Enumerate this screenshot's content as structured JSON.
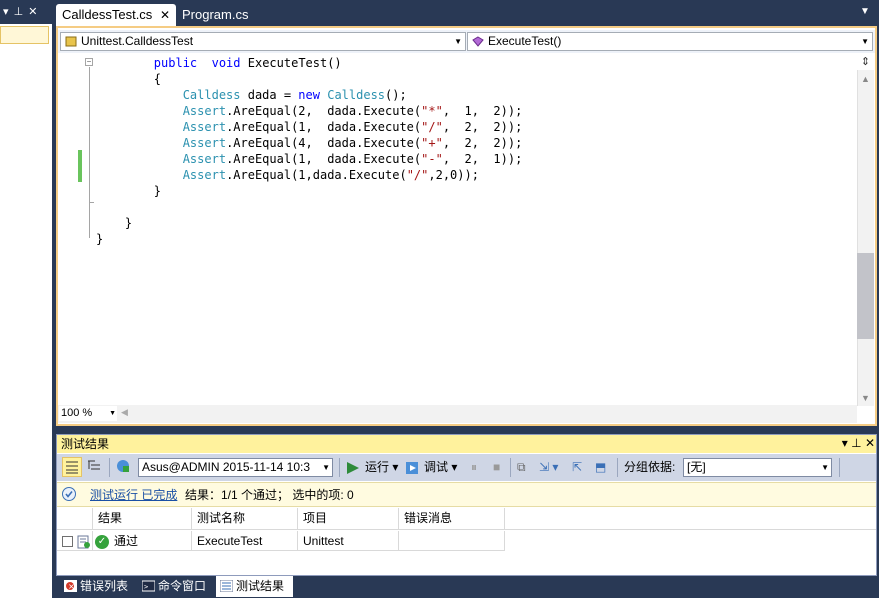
{
  "left_pane": {
    "header_glyphs": "▾ ⊥ ✕"
  },
  "tabs": [
    {
      "label": "CalldessTest.cs",
      "active": true,
      "close": "✕"
    },
    {
      "label": "Program.cs",
      "active": false
    }
  ],
  "nav": {
    "class_combo": "Unittest.CalldessTest",
    "member_combo": "ExecuteTest()"
  },
  "code_lines": [
    {
      "indent": "        ",
      "parts": [
        [
          "kw",
          "public"
        ],
        [
          "",
          "  "
        ],
        [
          "kw",
          "void"
        ],
        [
          "",
          " ExecuteTest()"
        ]
      ]
    },
    {
      "indent": "        ",
      "parts": [
        [
          "",
          "{"
        ]
      ]
    },
    {
      "indent": "            ",
      "parts": [
        [
          "ty",
          "Calldess"
        ],
        [
          "",
          " dada = "
        ],
        [
          "kw",
          "new"
        ],
        [
          "",
          " "
        ],
        [
          "ty",
          "Calldess"
        ],
        [
          "",
          "();"
        ]
      ]
    },
    {
      "indent": "            ",
      "parts": [
        [
          "ty",
          "Assert"
        ],
        [
          "",
          ".AreEqual(2,  dada.Execute("
        ],
        [
          "st",
          "\"*\""
        ],
        [
          "",
          ",  1,  2));"
        ]
      ]
    },
    {
      "indent": "            ",
      "parts": [
        [
          "ty",
          "Assert"
        ],
        [
          "",
          ".AreEqual(1,  dada.Execute("
        ],
        [
          "st",
          "\"/\""
        ],
        [
          "",
          ",  2,  2));"
        ]
      ]
    },
    {
      "indent": "            ",
      "parts": [
        [
          "ty",
          "Assert"
        ],
        [
          "",
          ".AreEqual(4,  dada.Execute("
        ],
        [
          "st",
          "\"+\""
        ],
        [
          "",
          ",  2,  2));"
        ]
      ]
    },
    {
      "indent": "            ",
      "parts": [
        [
          "ty",
          "Assert"
        ],
        [
          "",
          ".AreEqual(1,  dada.Execute("
        ],
        [
          "st",
          "\"-\""
        ],
        [
          "",
          ",  2,  1));"
        ]
      ]
    },
    {
      "indent": "            ",
      "parts": [
        [
          "ty",
          "Assert"
        ],
        [
          "",
          ".AreEqual(1,dada.Execute("
        ],
        [
          "st",
          "\"/\""
        ],
        [
          "",
          ",2,0));"
        ]
      ]
    },
    {
      "indent": "        ",
      "parts": [
        [
          "",
          "}"
        ]
      ]
    },
    {
      "indent": "",
      "parts": [
        [
          "",
          ""
        ]
      ]
    },
    {
      "indent": "    ",
      "parts": [
        [
          "",
          "}"
        ]
      ]
    },
    {
      "indent": "",
      "parts": [
        [
          "",
          "}"
        ]
      ]
    }
  ],
  "zoom": "100 %",
  "results": {
    "title": "测试结果",
    "title_buttons": "▾ ⊥ ✕",
    "toolbar": {
      "run_config": "Asus@ADMIN 2015-11-14 10:3",
      "run_label": "运行",
      "debug_label": "调试",
      "group_by_label": "分组依据:",
      "group_by_value": "[无]"
    },
    "status_link": "测试运行 已完成",
    "status_text": "结果：1/1 个通过；   选中的项: 0",
    "columns": [
      "结果",
      "测试名称",
      "项目",
      "错误消息"
    ],
    "rows": [
      {
        "result": "通过",
        "test_name": "ExecuteTest",
        "project": "Unittest",
        "error": ""
      }
    ]
  },
  "bottom_tabs": [
    {
      "label": "错误列表",
      "icon": "error-list-icon",
      "active": false
    },
    {
      "label": "命令窗口",
      "icon": "command-window-icon",
      "active": false
    },
    {
      "label": "测试结果",
      "icon": "test-results-icon",
      "active": true
    }
  ],
  "colors": {
    "chrome": "#293955",
    "active_border": "#f5cc84",
    "pane_title": "#fff29d",
    "keyword": "#0000ff",
    "type": "#2b91af",
    "string": "#a31515",
    "pass": "#35a23c"
  }
}
